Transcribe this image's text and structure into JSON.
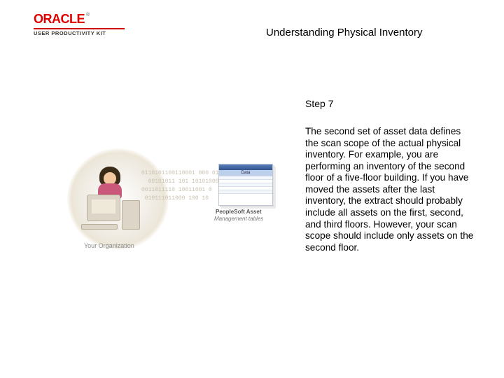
{
  "header": {
    "brand_main": "ORACLE",
    "brand_tm": "®",
    "brand_sub": "USER PRODUCTIVITY KIT",
    "page_title": "Understanding Physical Inventory"
  },
  "content": {
    "step_label": "Step 7",
    "body": "The second set of asset data defines the scan scope of the actual physical inventory. For example, you are performing an inventory of the second floor of a five-floor building. If you have moved the assets after the last inventory, the extract should probably include all assets on the first, second, and third floors. However, your scan scope should include only assets on the second floor."
  },
  "illustration": {
    "binary_sample": "0110101100110001 000 01\n  00101011 101 101010001\n0011011110 10011001 0\n 010111011000 100 10",
    "workstation_caption": "Your Organization",
    "db_inset_title": "Data",
    "db_label_line1": "PeopleSoft Asset",
    "db_label_line2": "Management tables"
  }
}
